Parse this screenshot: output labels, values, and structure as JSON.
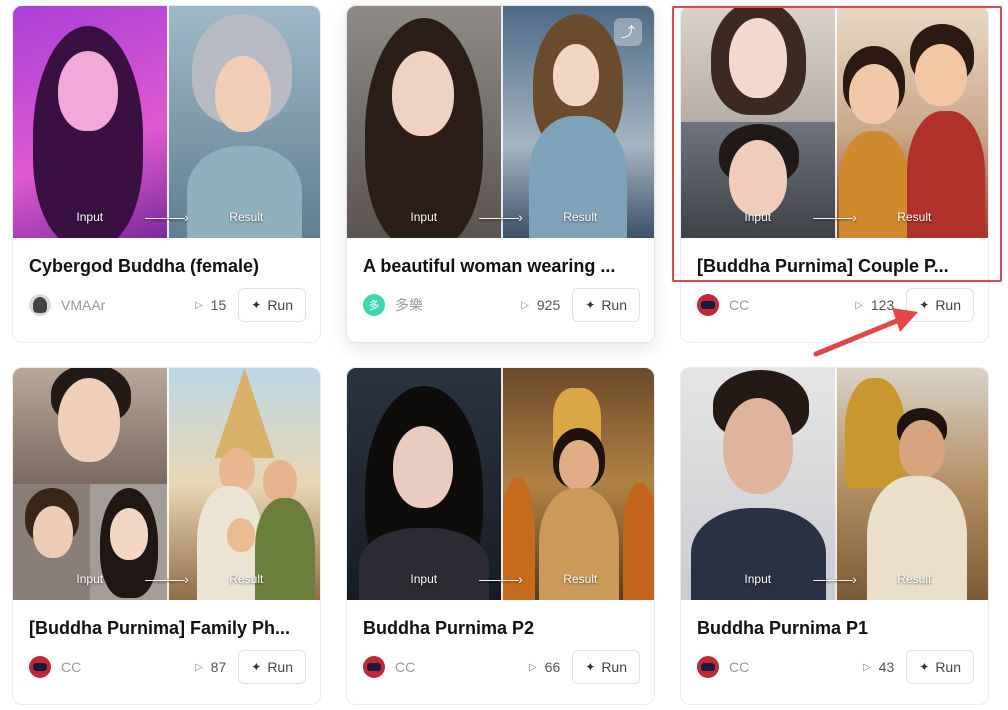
{
  "cards": [
    {
      "title": "Cybergod Buddha (female)",
      "author": "VMAAr",
      "runs": "15",
      "run_label": "Run",
      "input_label": "Input",
      "result_label": "Result",
      "arrow": "———›"
    },
    {
      "title": "A beautiful woman wearing ...",
      "author": "多樂",
      "author_avatar_text": "多",
      "runs": "925",
      "run_label": "Run",
      "input_label": "Input",
      "result_label": "Result",
      "arrow": "———›"
    },
    {
      "title": "[Buddha Purnima] Couple P...",
      "author": "CC",
      "runs": "123",
      "run_label": "Run",
      "input_label": "Input",
      "result_label": "Result",
      "arrow": "———›"
    },
    {
      "title": "[Buddha Purnima] Family Ph...",
      "author": "CC",
      "runs": "87",
      "run_label": "Run",
      "input_label": "Input",
      "result_label": "Result",
      "arrow": "———›"
    },
    {
      "title": "Buddha Purnima P2",
      "author": "CC",
      "runs": "66",
      "run_label": "Run",
      "input_label": "Input",
      "result_label": "Result",
      "arrow": "———›"
    },
    {
      "title": "Buddha Purnima P1",
      "author": "CC",
      "runs": "43",
      "run_label": "Run",
      "input_label": "Input",
      "result_label": "Result",
      "arrow": "———›"
    }
  ],
  "icons": {
    "play": "play-icon",
    "run": "magic-wand-icon",
    "share": "share-icon"
  },
  "colors": {
    "highlight": "#e04848",
    "avatar_cc": "#c0283a",
    "avatar_duo": "#3dd6b0"
  }
}
